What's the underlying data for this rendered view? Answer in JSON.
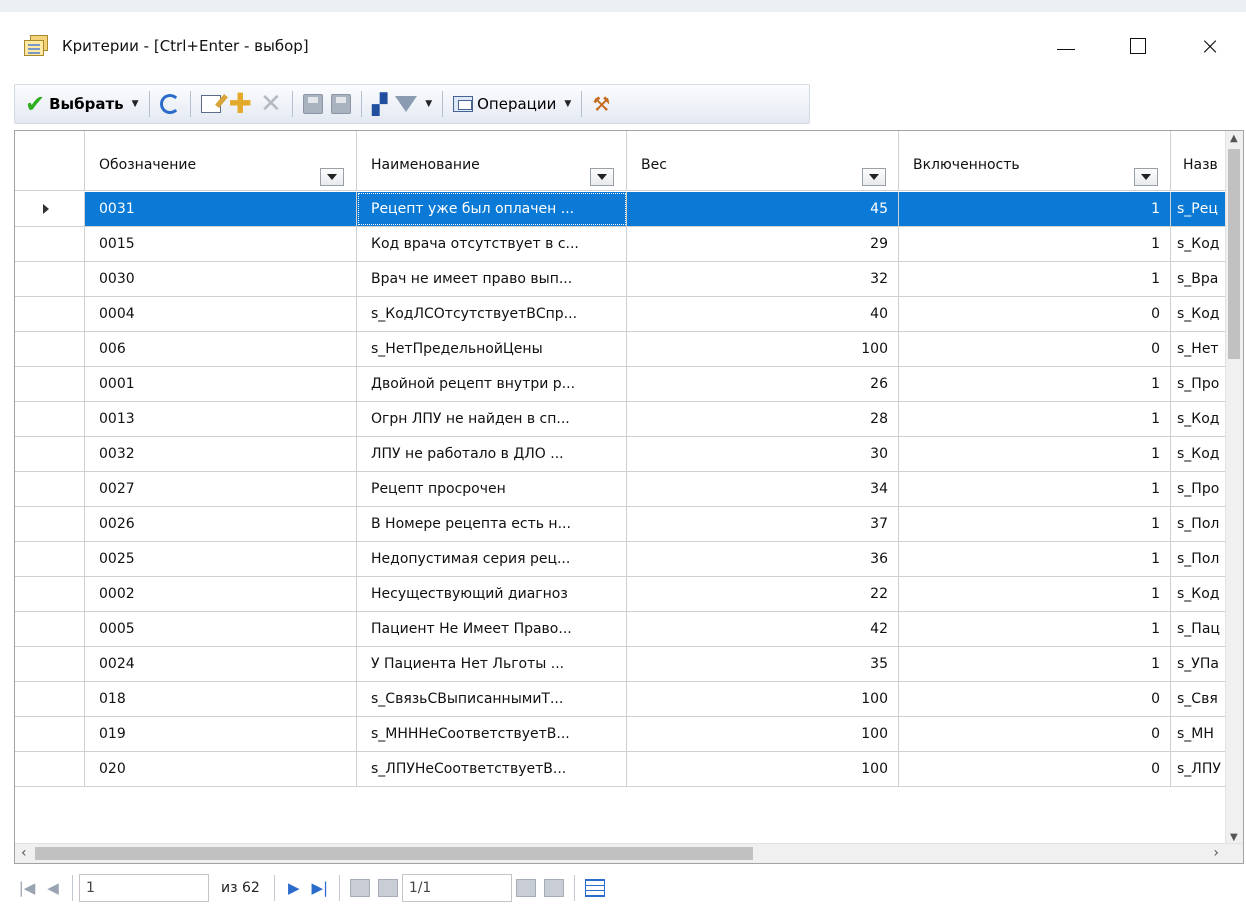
{
  "window": {
    "title": "Критерии - [Ctrl+Enter - выбор]",
    "controls": {
      "minimize": "—",
      "maximize": "",
      "close": "×"
    }
  },
  "toolbar": {
    "select_label": "Выбрать",
    "operations_label": "Операции"
  },
  "grid": {
    "columns": [
      {
        "label": "Обозначение"
      },
      {
        "label": "Наименование"
      },
      {
        "label": "Вес"
      },
      {
        "label": "Включенность"
      },
      {
        "label": "Назв"
      }
    ],
    "rows": [
      {
        "code": "0031",
        "name": "Рецепт уже был оплачен ...",
        "weight": "45",
        "included": "1",
        "extra": "s_Рец"
      },
      {
        "code": "0015",
        "name": "Код врача отсутствует в с...",
        "weight": "29",
        "included": "1",
        "extra": "s_Код"
      },
      {
        "code": "0030",
        "name": "Врач не имеет право вып...",
        "weight": "32",
        "included": "1",
        "extra": "s_Вра"
      },
      {
        "code": "0004",
        "name": "s_КодЛСОтсутствуетВСпр...",
        "weight": "40",
        "included": "0",
        "extra": "s_Код"
      },
      {
        "code": "006",
        "name": "s_НетПредельнойЦены",
        "weight": "100",
        "included": "0",
        "extra": "s_Нет"
      },
      {
        "code": "0001",
        "name": "Двойной рецепт внутри р...",
        "weight": "26",
        "included": "1",
        "extra": "s_Про"
      },
      {
        "code": "0013",
        "name": "Огрн ЛПУ не найден в сп...",
        "weight": "28",
        "included": "1",
        "extra": "s_Код"
      },
      {
        "code": "0032",
        "name": "ЛПУ не работало в ДЛО ...",
        "weight": "30",
        "included": "1",
        "extra": "s_Код"
      },
      {
        "code": "0027",
        "name": "Рецепт просрочен",
        "weight": "34",
        "included": "1",
        "extra": "s_Про"
      },
      {
        "code": "0026",
        "name": "В Номере рецепта есть н...",
        "weight": "37",
        "included": "1",
        "extra": "s_Пол"
      },
      {
        "code": "0025",
        "name": "Недопустимая серия рец...",
        "weight": "36",
        "included": "1",
        "extra": "s_Пол"
      },
      {
        "code": "0002",
        "name": "Несуществующий диагноз",
        "weight": "22",
        "included": "1",
        "extra": "s_Код"
      },
      {
        "code": "0005",
        "name": "Пациент Не Имеет Право...",
        "weight": "42",
        "included": "1",
        "extra": "s_Пац"
      },
      {
        "code": "0024",
        "name": "У Пациента Нет Льготы ...",
        "weight": "35",
        "included": "1",
        "extra": "s_УПа"
      },
      {
        "code": "018",
        "name": "s_СвязьСВыписаннымиТ...",
        "weight": "100",
        "included": "0",
        "extra": "s_Свя"
      },
      {
        "code": "019",
        "name": "s_МНННеСоответствуетВ...",
        "weight": "100",
        "included": "0",
        "extra": "s_МН"
      },
      {
        "code": "020",
        "name": "s_ЛПУНеСоответствуетВ...",
        "weight": "100",
        "included": "0",
        "extra": "s_ЛПУ"
      }
    ],
    "selected_index": 0
  },
  "navigator": {
    "current_record": "1",
    "of_label": "из 62",
    "page": "1/1"
  },
  "colors": {
    "selection": "#0a7ad6",
    "accent": "#2a6bcc"
  }
}
